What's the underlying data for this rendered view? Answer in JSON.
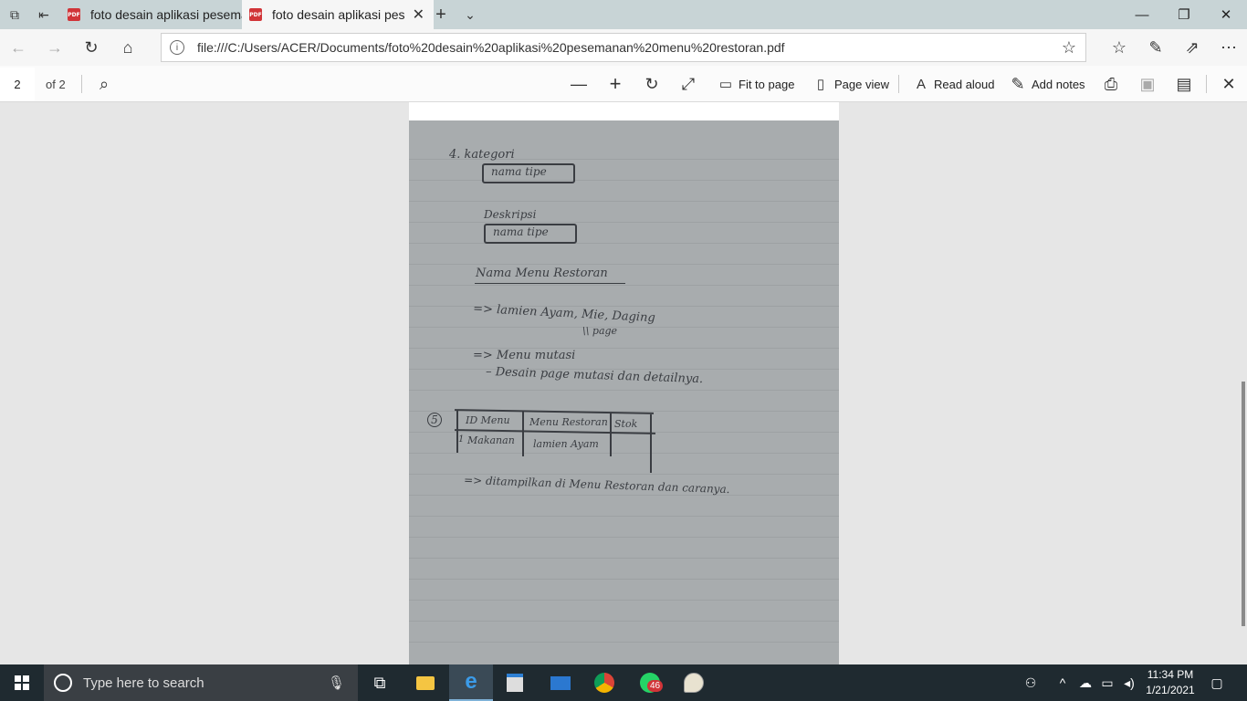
{
  "tabs": [
    {
      "title": "foto desain aplikasi pesema",
      "icon": "PDF"
    },
    {
      "title": "foto desain aplikasi pes",
      "icon": "PDF"
    }
  ],
  "window": {
    "minimize": "—",
    "restore": "❐",
    "close": "✕"
  },
  "address": {
    "url": "file:///C:/Users/ACER/Documents/foto%20desain%20aplikasi%20pesemanan%20menu%20restoran.pdf"
  },
  "pdf_toolbar": {
    "page_number": "2",
    "page_of": "of 2",
    "fit_to_page": "Fit to page",
    "page_view": "Page view",
    "read_aloud": "Read aloud",
    "add_notes": "Add notes"
  },
  "handwriting": {
    "l1": "4.  kategori",
    "l2": "nama tipe",
    "l3": "Deskripsi",
    "l4": "nama tipe",
    "l5": "Nama Menu Restoran",
    "l6": "=> lamien Ayam, Mie, Daging",
    "l7": "\\\\ page",
    "l8": "=> Menu mutasi",
    "l9": "– Desain page mutasi dan detailnya.",
    "num5": "5",
    "th1": "ID Menu",
    "th2": "Menu Restoran",
    "th3": "Stok",
    "td0": "1",
    "td1": "Makanan",
    "td2": "lamien Ayam",
    "l10": "=> ditampilkan di Menu Restoran dan caranya."
  },
  "taskbar": {
    "search_placeholder": "Type here to search",
    "whatsapp_badge": "46",
    "time": "11:34 PM",
    "date": "1/21/2021"
  }
}
